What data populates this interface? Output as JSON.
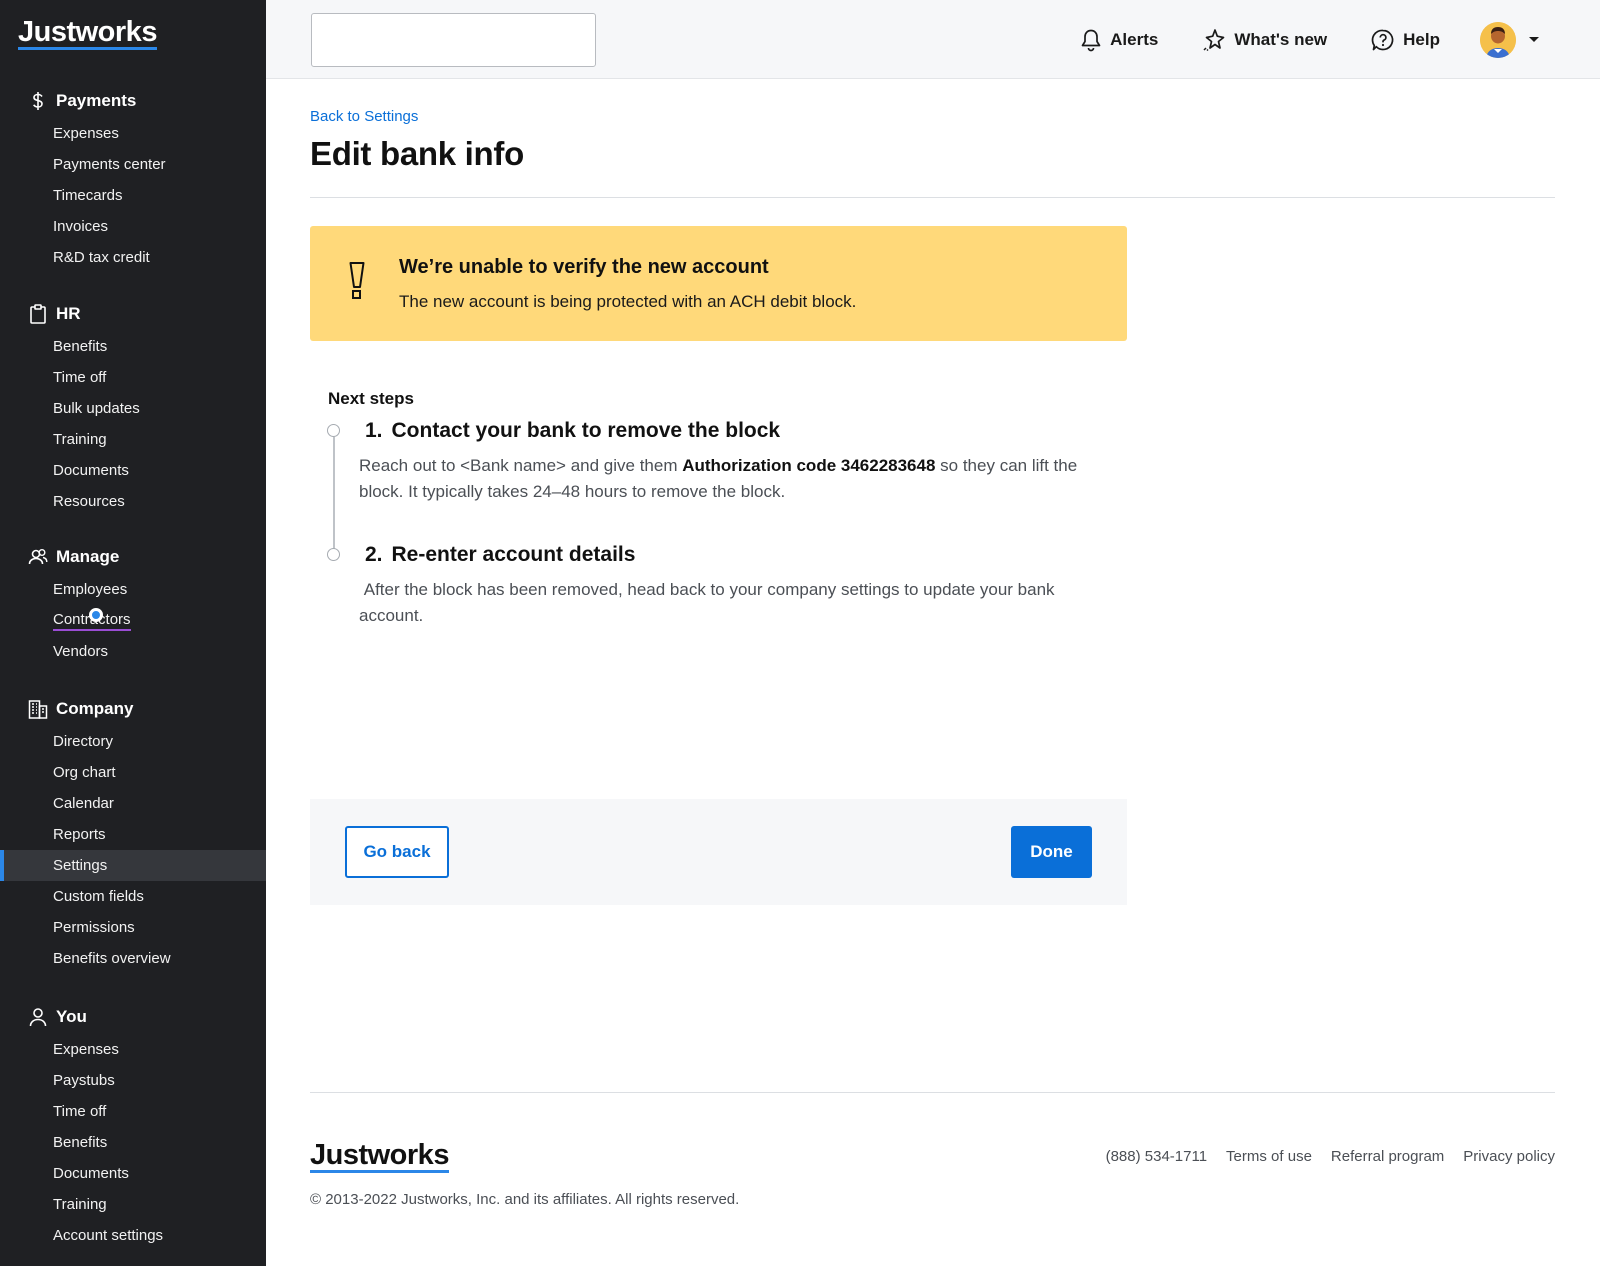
{
  "brand": {
    "name": "Justworks"
  },
  "sidebar": {
    "sections": [
      {
        "title": "Payments",
        "icon": "dollar-icon",
        "items": [
          "Expenses",
          "Payments center",
          "Timecards",
          "Invoices",
          "R&D tax credit"
        ]
      },
      {
        "title": "HR",
        "icon": "clipboard-icon",
        "items": [
          "Benefits",
          "Time off",
          "Bulk updates",
          "Training",
          "Documents",
          "Resources"
        ]
      },
      {
        "title": "Manage",
        "icon": "people-icon",
        "items": [
          "Employees",
          "Contractors",
          "Vendors"
        ]
      },
      {
        "title": "Company",
        "icon": "building-icon",
        "items": [
          "Directory",
          "Org chart",
          "Calendar",
          "Reports",
          "Settings",
          "Custom fields",
          "Permissions",
          "Benefits overview"
        ]
      },
      {
        "title": "You",
        "icon": "person-icon",
        "items": [
          "Expenses",
          "Paystubs",
          "Time off",
          "Benefits",
          "Documents",
          "Training",
          "Account settings"
        ]
      }
    ],
    "active_item": "Settings"
  },
  "header": {
    "search_value": "",
    "alerts_label": "Alerts",
    "whats_new_label": "What's new",
    "help_label": "Help"
  },
  "main": {
    "back_link": "Back to Settings",
    "title": "Edit bank info",
    "alert": {
      "title": "We’re unable to verify the new account",
      "body": "The new account is being protected with an ACH debit block."
    },
    "next_steps_label": "Next steps",
    "steps": [
      {
        "number": "1.",
        "title": "Contact your bank to remove the block",
        "body_pre": "Reach out to <Bank name> and give them ",
        "body_bold": "Authorization code 3462283648",
        "body_post": " so they can lift the block. It typically takes 24–48 hours to remove the block."
      },
      {
        "number": "2.",
        "title": "Re-enter account details",
        "body": " After the block has been removed, head back to your company settings to update your bank account."
      }
    ],
    "go_back_label": "Go back",
    "done_label": "Done"
  },
  "footer": {
    "phone": "(888) 534-1711",
    "terms": "Terms of use",
    "referral": "Referral program",
    "privacy": "Privacy policy",
    "copyright": "© 2013-2022 Justworks, Inc. and its affiliates. All rights reserved."
  },
  "colors": {
    "sidebar_bg": "#1f2023",
    "accent_blue": "#0a6fd8",
    "alert_bg": "#ffd97a"
  }
}
